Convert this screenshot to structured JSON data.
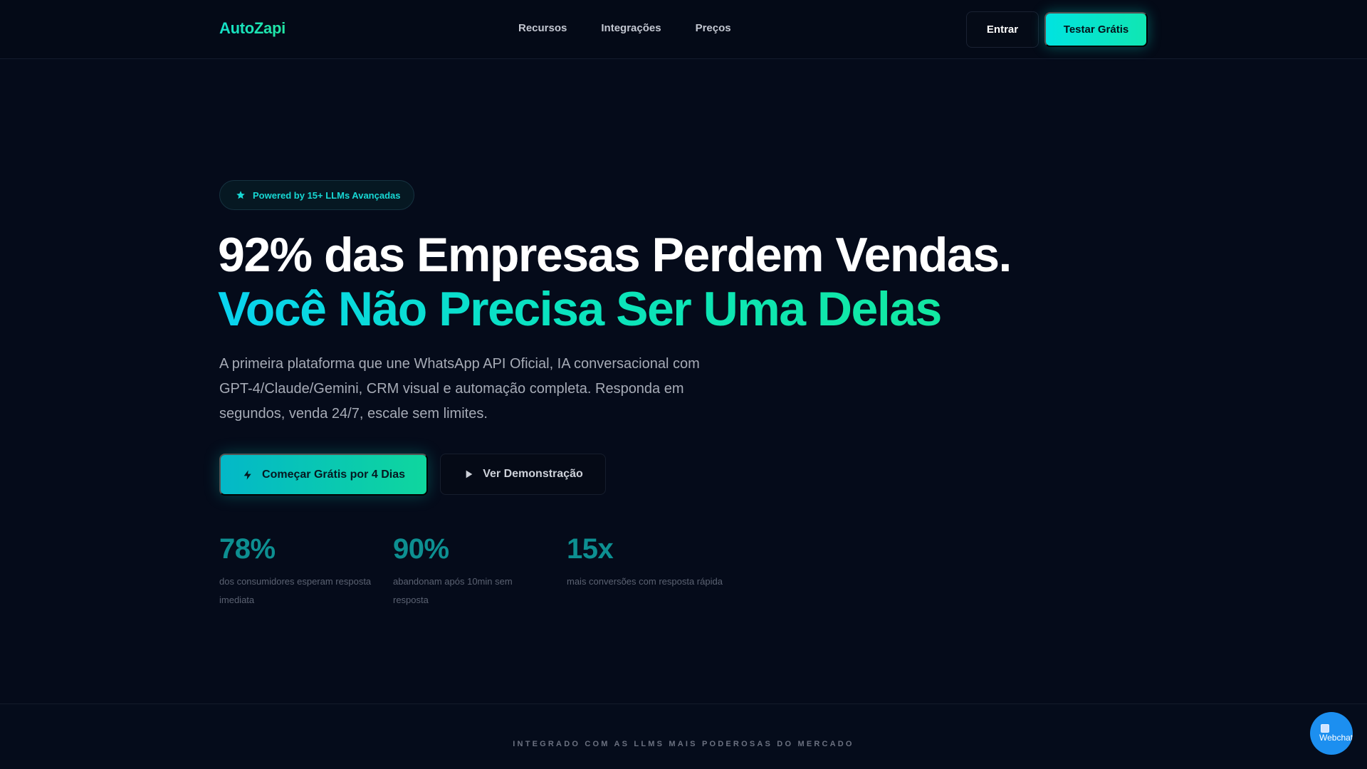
{
  "nav": {
    "logo": "AutoZapi",
    "links": [
      "Recursos",
      "Integrações",
      "Preços"
    ],
    "login_label": "Entrar",
    "trial_label": "Testar Grátis"
  },
  "hero": {
    "badge": "Powered by 15+ LLMs Avançadas",
    "headline": "92% das Empresas Perdem Vendas.",
    "headline_accent": "Você Não Precisa Ser Uma Delas",
    "lead": "A primeira plataforma que une WhatsApp API Oficial, IA conversacional com GPT-4/Claude/Gemini, CRM visual e automação completa. Responda em segundos, venda 24/7, escale sem limites.",
    "cta_primary": "Começar Grátis por 4 Dias",
    "cta_secondary": "Ver Demonstração",
    "stats": [
      {
        "value": "78%",
        "label": "dos consumidores esperam resposta imediata"
      },
      {
        "value": "90%",
        "label": "abandonam após 10min sem resposta"
      },
      {
        "value": "15x",
        "label": "mais conversões com resposta rápida"
      }
    ]
  },
  "integrations": {
    "heading": "INTEGRADO COM AS LLMS MAIS PODEROSAS DO MERCADO"
  },
  "widget": {
    "alt_text": "Webchat",
    "icon": "chat-widget-icon"
  },
  "colors": {
    "background": "#050b1a",
    "accent": "#0ae3c0",
    "accent_cyan": "#00e3e0",
    "stat_color": "#0d8f91",
    "widget_blue": "#1c8ff0"
  }
}
